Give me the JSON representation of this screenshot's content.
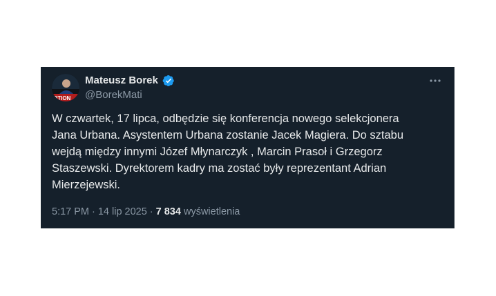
{
  "author": {
    "name": "Mateusz Borek",
    "handle": "@BorekMati",
    "avatar_banner_text": "OTION"
  },
  "tweet": {
    "text": "W czwartek, 17 lipca, odbędzie się konferencja nowego selekcjonera\nJana Urbana. Asystentem Urbana zostanie Jacek Magiera. Do sztabu\nwejdą między innymi Józef Młynarczyk , Marcin Prasoł i Grzegorz\nStaszewski. Dyrektorem kadry ma zostać były reprezentant Adrian\nMierzejewski.",
    "time": "5:17 PM",
    "separator": "·",
    "date": "14 lip 2025",
    "views_count": "7 834",
    "views_label": "wyświetlenia"
  },
  "icons": {
    "verified": "verified-badge-icon",
    "more": "more-options-icon"
  },
  "colors": {
    "background": "#15202b",
    "text": "#e7e9ea",
    "secondary_text": "#8b98a5",
    "verified": "#1d9bf0"
  }
}
